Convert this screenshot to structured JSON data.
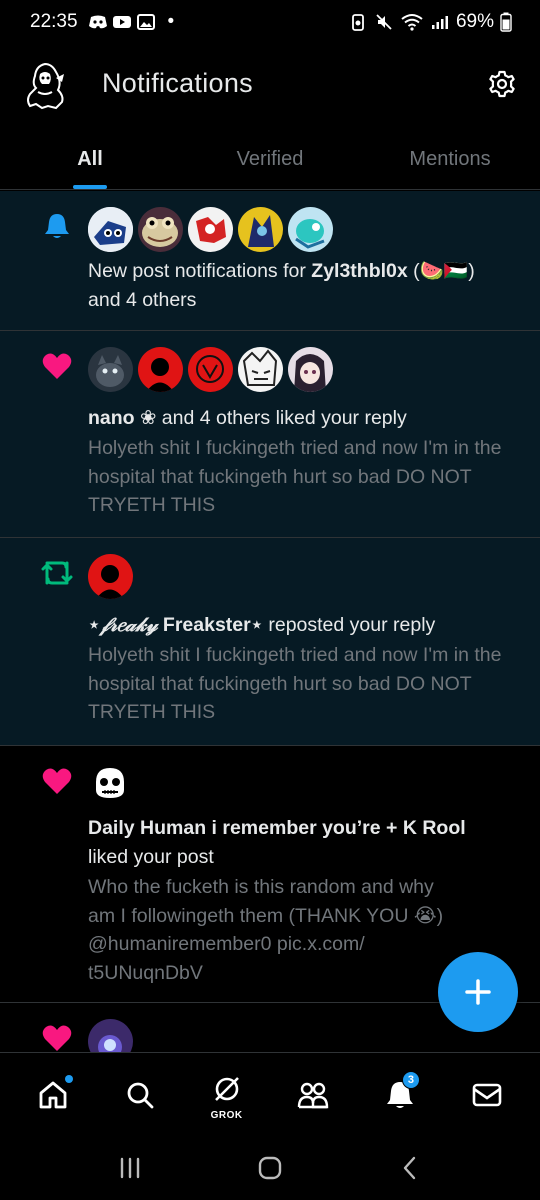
{
  "status_bar": {
    "time": "22:35",
    "battery": "69%",
    "dot": "•"
  },
  "header": {
    "title": "Notifications"
  },
  "tabs": [
    {
      "label": "All",
      "active": true
    },
    {
      "label": "Verified",
      "active": false
    },
    {
      "label": "Mentions",
      "active": false
    }
  ],
  "notifications": [
    {
      "type": "bell-icon",
      "unread": true,
      "text_prefix": "New post notifications for ",
      "user": "Zyl3thbl0x",
      "user_suffix": " (🍉🇵🇸)",
      "text_suffix": "and 4 others"
    },
    {
      "type": "heart-icon",
      "unread": true,
      "user": "nano ❀",
      "text": " and 4 others liked your reply",
      "sub": "Holyeth shit I fuckingeth tried and now I'm in the hospital that fuckingeth hurt so bad DO NOT TRYETH THIS"
    },
    {
      "type": "repost-icon",
      "unread": true,
      "user_italic": "⋆𝒻𝓇𝑒𝒶𝓀𝓎",
      "user": " Freakster⋆",
      "text": " reposted your reply",
      "sub": "Holyeth shit I fuckingeth tried and now I'm in the hospital that fuckingeth hurt so bad DO NOT TRYETH THIS"
    },
    {
      "type": "heart-icon",
      "unread": false,
      "user": "Daily Human i remember you’re + K Rool",
      "text": "liked your post",
      "sub": "Who the fucketh is this random and why am I followingeth them (THANK YOU 😭) @humaniremember0 pic.x.com/ t5UNuqnDbV"
    }
  ],
  "bottom_nav": {
    "grok_label": "GROK",
    "notifications_badge": "3"
  },
  "colors": {
    "accent": "#1d9bf0",
    "heart": "#f91880",
    "repost": "#00ba7c",
    "unread_bg": "#061a24"
  }
}
